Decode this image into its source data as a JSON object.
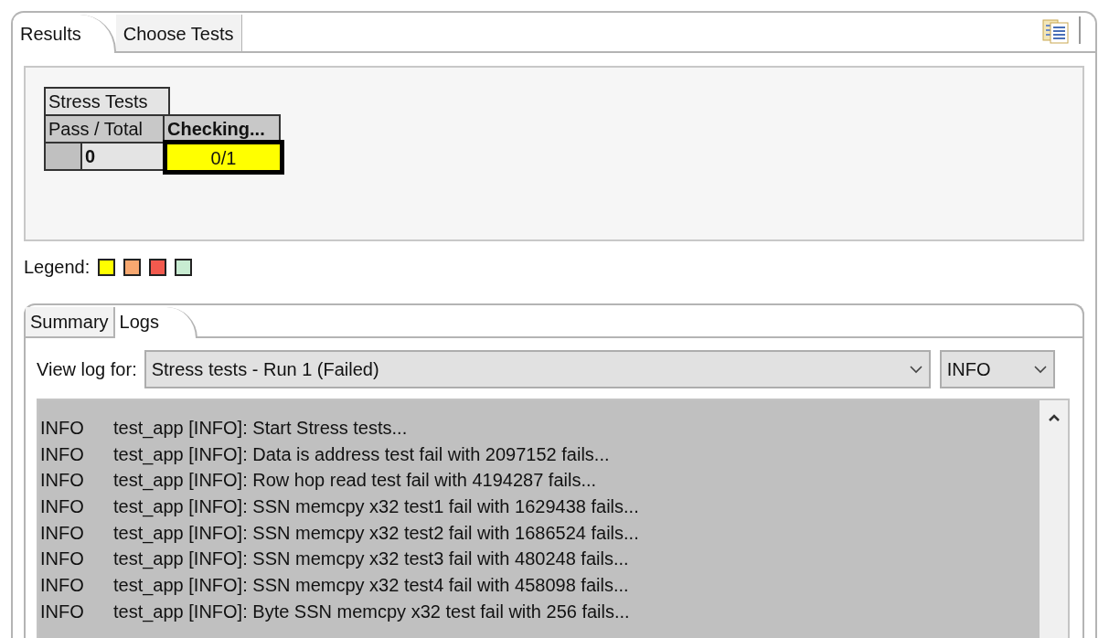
{
  "tabs": [
    {
      "label": "Results",
      "selected": true
    },
    {
      "label": "Choose Tests",
      "selected": false
    }
  ],
  "results_table": {
    "group": "Stress Tests",
    "header": "Pass / Total",
    "status": "Checking...",
    "pass": "0",
    "result": {
      "text": "0/1",
      "color": "#ffff00",
      "selected": true
    }
  },
  "legend": {
    "label": "Legend:",
    "colors": [
      {
        "color": "#ffff00"
      },
      {
        "color": "#f7a870"
      },
      {
        "color": "#f25a4e"
      },
      {
        "color": "#c8ecd2"
      }
    ]
  },
  "inner_tabs": [
    {
      "label": "Summary",
      "selected": false
    },
    {
      "label": "Logs",
      "selected": true
    }
  ],
  "log_view": {
    "label": "View log for:",
    "run": "Stress tests - Run 1 (Failed)",
    "level": "INFO"
  },
  "log_rows": [
    {
      "level": "INFO",
      "message": "test_app [INFO]: Start Stress tests..."
    },
    {
      "level": "INFO",
      "message": "test_app [INFO]: Data is address test fail with 2097152 fails..."
    },
    {
      "level": "INFO",
      "message": "test_app [INFO]: Row hop read test fail with 4194287 fails..."
    },
    {
      "level": "INFO",
      "message": "test_app [INFO]: SSN memcpy x32 test1 fail with 1629438 fails..."
    },
    {
      "level": "INFO",
      "message": "test_app [INFO]: SSN memcpy x32 test2 fail with 1686524 fails..."
    },
    {
      "level": "INFO",
      "message": "test_app [INFO]: SSN memcpy x32 test3 fail with 480248 fails..."
    },
    {
      "level": "INFO",
      "message": "test_app [INFO]: SSN memcpy x32 test4 fail with 458098 fails..."
    },
    {
      "level": "INFO",
      "message": "test_app [INFO]: Byte SSN memcpy x32 test fail with 256 fails..."
    }
  ]
}
